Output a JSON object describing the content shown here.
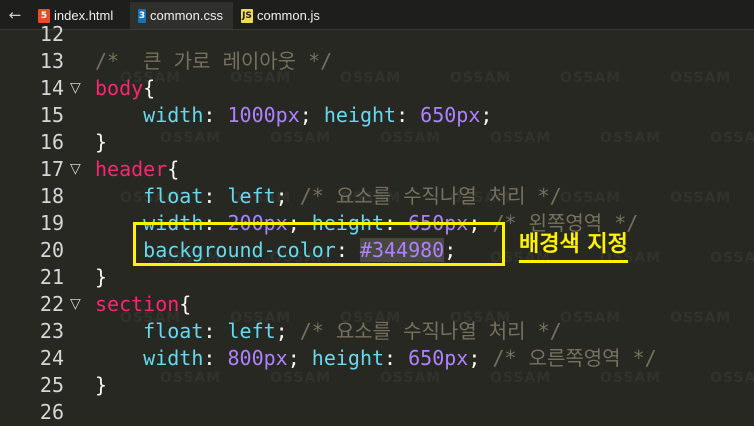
{
  "tabs": [
    {
      "name": "index.html",
      "icon": "5",
      "type": "html"
    },
    {
      "name": "common.css",
      "icon": "3",
      "type": "css"
    },
    {
      "name": "common.js",
      "icon": "JS",
      "type": "js"
    }
  ],
  "back_glyph": "←",
  "fold_glyph": "▽",
  "watermark": "OSSAM",
  "callout": "배경색 지정",
  "code_lines": [
    {
      "num": "12",
      "tokens": []
    },
    {
      "num": "13",
      "tokens": [
        {
          "t": "/*  큰 가로 레이아웃 */",
          "c": "comment"
        }
      ]
    },
    {
      "num": "14",
      "fold": true,
      "tokens": [
        {
          "t": "body",
          "c": "sel"
        },
        {
          "t": "{",
          "c": "punct"
        }
      ]
    },
    {
      "num": "15",
      "tokens": [
        {
          "t": "    ",
          "c": "punct"
        },
        {
          "t": "width",
          "c": "prop"
        },
        {
          "t": ": ",
          "c": "punct"
        },
        {
          "t": "1000px",
          "c": "val"
        },
        {
          "t": "; ",
          "c": "punct"
        },
        {
          "t": "height",
          "c": "prop"
        },
        {
          "t": ": ",
          "c": "punct"
        },
        {
          "t": "650px",
          "c": "val"
        },
        {
          "t": ";",
          "c": "punct"
        }
      ]
    },
    {
      "num": "16",
      "tokens": [
        {
          "t": "}",
          "c": "punct"
        }
      ]
    },
    {
      "num": "17",
      "fold": true,
      "tokens": [
        {
          "t": "header",
          "c": "sel"
        },
        {
          "t": "{",
          "c": "punct"
        }
      ]
    },
    {
      "num": "18",
      "tokens": [
        {
          "t": "    ",
          "c": "punct"
        },
        {
          "t": "float",
          "c": "prop"
        },
        {
          "t": ": ",
          "c": "punct"
        },
        {
          "t": "left",
          "c": "prop"
        },
        {
          "t": "; ",
          "c": "punct"
        },
        {
          "t": "/* 요소를 수직나열 처리 */",
          "c": "comment"
        }
      ]
    },
    {
      "num": "19",
      "tokens": [
        {
          "t": "    ",
          "c": "punct"
        },
        {
          "t": "width",
          "c": "prop"
        },
        {
          "t": ": ",
          "c": "punct"
        },
        {
          "t": "200px",
          "c": "val"
        },
        {
          "t": "; ",
          "c": "punct"
        },
        {
          "t": "height",
          "c": "prop"
        },
        {
          "t": ": ",
          "c": "punct"
        },
        {
          "t": "650px",
          "c": "val"
        },
        {
          "t": "; ",
          "c": "punct"
        },
        {
          "t": "/* 왼쪽영역 */",
          "c": "comment"
        }
      ]
    },
    {
      "num": "20",
      "tokens": [
        {
          "t": "    ",
          "c": "punct"
        },
        {
          "t": "background-color",
          "c": "prop"
        },
        {
          "t": ": ",
          "c": "punct"
        },
        {
          "t": "#344980",
          "c": "hl"
        },
        {
          "t": ";",
          "c": "punct"
        }
      ]
    },
    {
      "num": "21",
      "tokens": [
        {
          "t": "}",
          "c": "punct"
        }
      ]
    },
    {
      "num": "22",
      "fold": true,
      "tokens": [
        {
          "t": "section",
          "c": "sel"
        },
        {
          "t": "{",
          "c": "punct"
        }
      ]
    },
    {
      "num": "23",
      "tokens": [
        {
          "t": "    ",
          "c": "punct"
        },
        {
          "t": "float",
          "c": "prop"
        },
        {
          "t": ": ",
          "c": "punct"
        },
        {
          "t": "left",
          "c": "prop"
        },
        {
          "t": "; ",
          "c": "punct"
        },
        {
          "t": "/* 요소를 수직나열 처리 */",
          "c": "comment"
        }
      ]
    },
    {
      "num": "24",
      "tokens": [
        {
          "t": "    ",
          "c": "punct"
        },
        {
          "t": "width",
          "c": "prop"
        },
        {
          "t": ": ",
          "c": "punct"
        },
        {
          "t": "800px",
          "c": "val"
        },
        {
          "t": "; ",
          "c": "punct"
        },
        {
          "t": "height",
          "c": "prop"
        },
        {
          "t": ": ",
          "c": "punct"
        },
        {
          "t": "650px",
          "c": "val"
        },
        {
          "t": "; ",
          "c": "punct"
        },
        {
          "t": "/* 오른쪽영역 */",
          "c": "comment"
        }
      ]
    },
    {
      "num": "25",
      "tokens": [
        {
          "t": "}",
          "c": "punct"
        }
      ]
    },
    {
      "num": "26",
      "tokens": []
    }
  ]
}
